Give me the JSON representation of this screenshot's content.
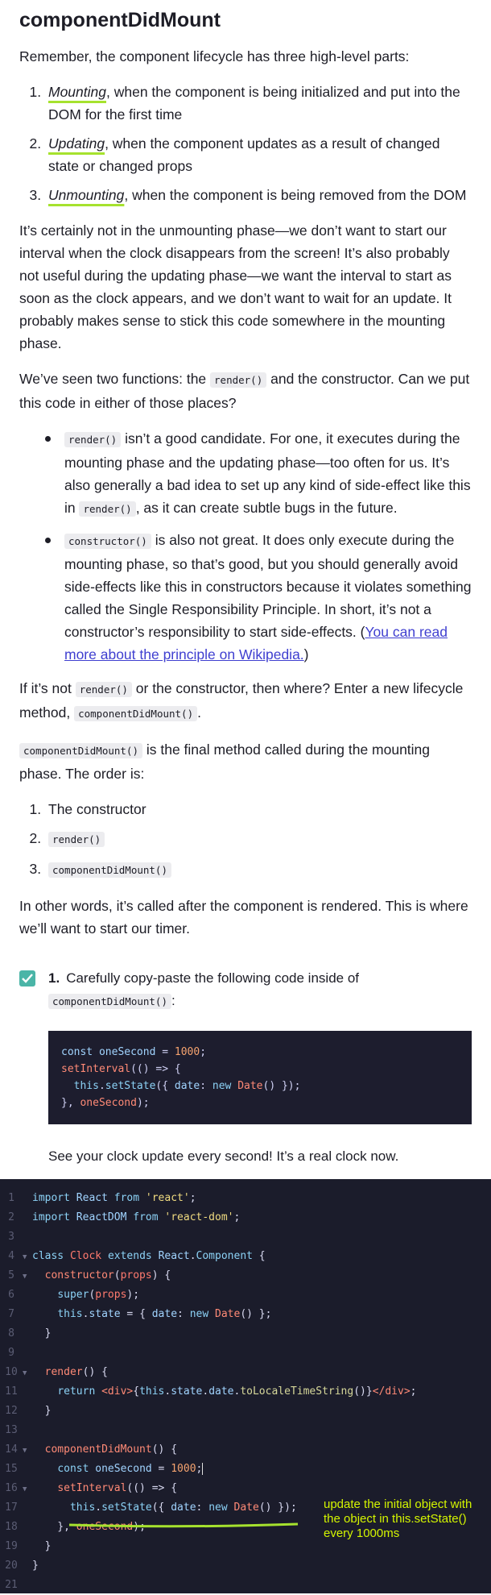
{
  "heading": "componentDidMount",
  "intro": "Remember, the component lifecycle has three high-level parts:",
  "phases": [
    {
      "term": "Mounting",
      "rest": ", when the component is being initialized and put into the DOM for the first time"
    },
    {
      "term": "Updating",
      "rest": ", when the component updates as a result of changed state or changed props"
    },
    {
      "term": "Unmounting",
      "rest": ", when the component is being removed from the DOM"
    }
  ],
  "para1": "It’s certainly not in the unmounting phase—we don’t want to start our interval when the clock disappears from the screen! It’s also probably not useful during the updating phase—we want the interval to start as soon as the clock appears, and we don’t want to wait for an update. It probably makes sense to stick this code somewhere in the mounting phase.",
  "para2": {
    "a": "We’ve seen two functions: the ",
    "code": "render()",
    "b": " and the constructor. Can we put this code in either of those places?"
  },
  "candidates": [
    {
      "code": "render()",
      "text": " isn’t a good candidate. For one, it executes during the mounting phase and the updating phase—too often for us. It’s also generally a bad idea to set up any kind of side-effect like this in ",
      "code2": "render()",
      "text2": ", as it can create subtle bugs in the future."
    },
    {
      "code": "constructor()",
      "text": " is also not great. It does only execute during the mounting phase, so that’s good, but you should generally avoid side-effects like this in constructors because it violates something called the Single Responsibility Principle. In short, it’s not a constructor’s responsibility to start side-effects. (",
      "link": "You can read more about the principle on Wikipedia.",
      "text2": ")"
    }
  ],
  "para3": {
    "a": "If it’s not ",
    "code": "render()",
    "b": " or the constructor, then where? Enter a new lifecycle method, ",
    "code2": "componentDidMount()",
    "c": "."
  },
  "para4": {
    "code": "componentDidMount()",
    "b": " is the final method called during the mounting phase. The order is:"
  },
  "order": [
    "The constructor",
    "render()",
    "componentDidMount()"
  ],
  "para5": "In other words, it’s called after the component is rendered. This is where we’ll want to start our timer.",
  "task": {
    "number": "1.",
    "text": "Carefully copy-paste the following code inside of ",
    "code": "componentDidMount()",
    "colon": ":",
    "snippet": [
      "const oneSecond = 1000;",
      "setInterval(() => {",
      "  this.setState({ date: new Date() });",
      "}, oneSecond);"
    ],
    "outro": "See your clock update every second! It’s a real clock now."
  },
  "editor": {
    "line_numbers": [
      "1",
      "2",
      "3",
      "4",
      "5",
      "6",
      "7",
      "8",
      "9",
      "10",
      "11",
      "12",
      "13",
      "14",
      "15",
      "16",
      "17",
      "18",
      "19",
      "20",
      "21"
    ]
  },
  "annotation": "update the initial object with the object in this.setState() every 1000ms",
  "colors": {
    "accent_underline": "#a6e22e",
    "annotation": "#d4f500",
    "check": "#4ab5a7",
    "editor_bg": "#1b1c2b"
  }
}
